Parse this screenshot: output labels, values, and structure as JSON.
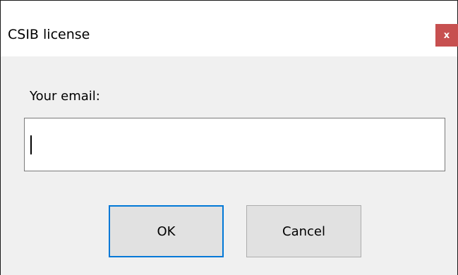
{
  "window": {
    "title": "CSIB license",
    "close_label": "x"
  },
  "form": {
    "email_label": "Your email:",
    "email_value": "",
    "email_placeholder": ""
  },
  "buttons": {
    "ok_label": "OK",
    "cancel_label": "Cancel"
  },
  "colors": {
    "close_button_bg": "#c75050",
    "default_button_border": "#0078d7",
    "dialog_bg": "#f0f0f0"
  }
}
